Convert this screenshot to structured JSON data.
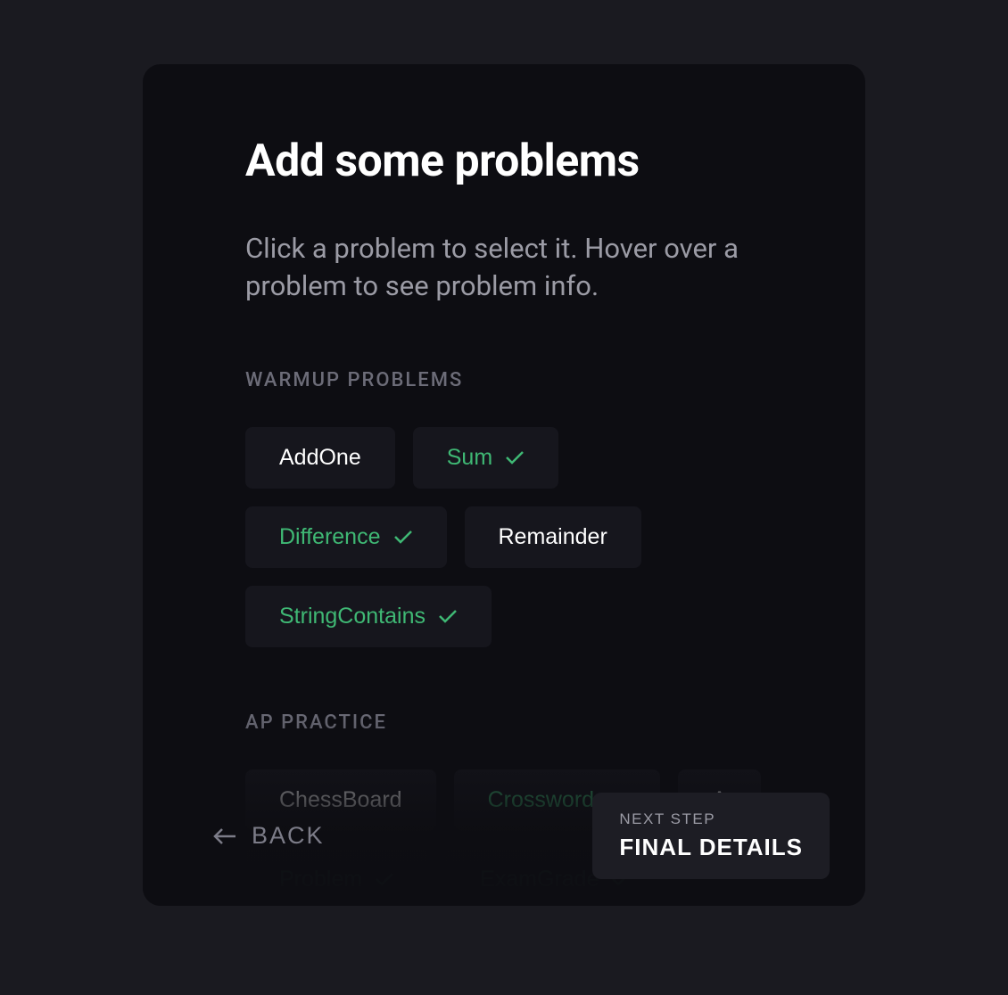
{
  "header": {
    "title": "Add some problems",
    "subtitle": "Click a problem to select it. Hover over a problem to see problem info."
  },
  "sections": [
    {
      "label": "WARMUP PROBLEMS",
      "items": [
        {
          "name": "AddOne",
          "selected": false
        },
        {
          "name": "Sum",
          "selected": true
        },
        {
          "name": "Difference",
          "selected": true
        },
        {
          "name": "Remainder",
          "selected": false
        },
        {
          "name": "StringContains",
          "selected": true
        }
      ]
    },
    {
      "label": "AP PRACTICE",
      "items": [
        {
          "name": "ChessBoard",
          "selected": false
        },
        {
          "name": "Crossword",
          "selected": true
        },
        {
          "name": "A",
          "selected": false
        },
        {
          "name": "Problem",
          "selected": true
        },
        {
          "name": "ExamGrade",
          "selected": true
        }
      ]
    }
  ],
  "footer": {
    "back_label": "BACK",
    "next_step_label": "NEXT STEP",
    "next_step_title": "FINAL DETAILS"
  }
}
